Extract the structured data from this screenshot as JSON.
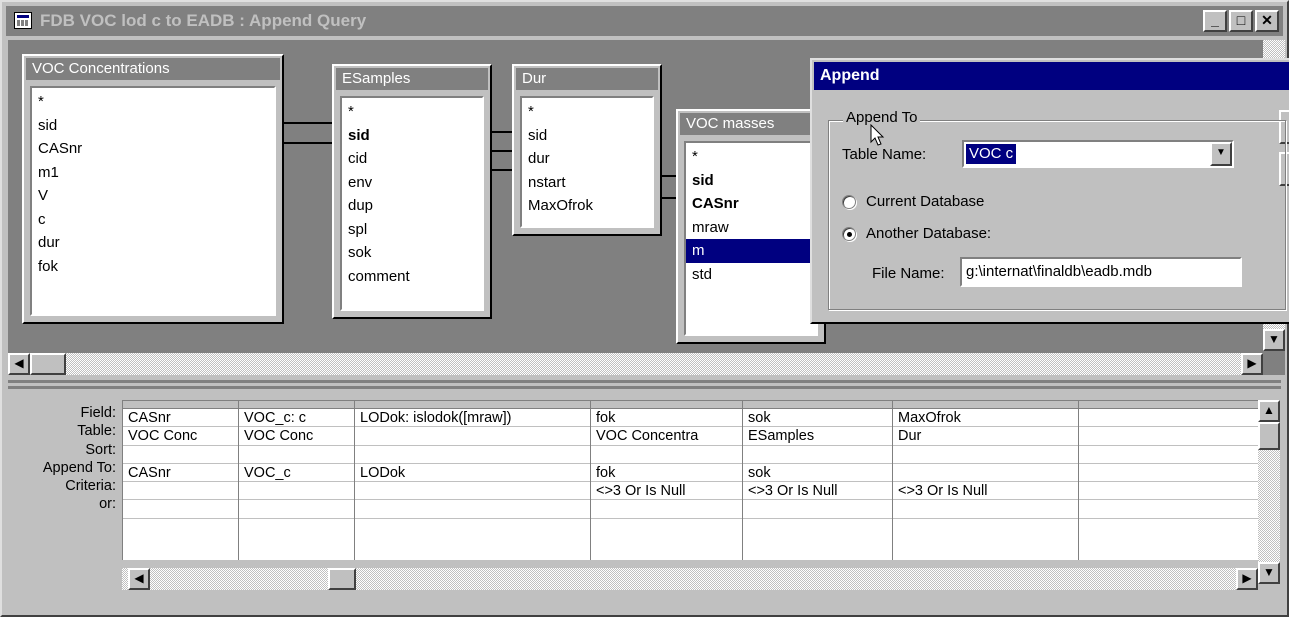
{
  "window": {
    "title": "FDB VOC lod c to EADB : Append Query",
    "minimize_glyph": "_",
    "maximize_glyph": "□",
    "close_glyph": "✕"
  },
  "tables": [
    {
      "caption": "VOC Concentrations",
      "fields": [
        "*",
        "sid",
        "CASnr",
        "m1",
        "V",
        "c",
        "dur",
        "fok"
      ]
    },
    {
      "caption": "ESamples",
      "fields": [
        "*",
        "sid",
        "cid",
        "env",
        "dup",
        "spl",
        "sok",
        "comment"
      ]
    },
    {
      "caption": "Dur",
      "fields": [
        "*",
        "sid",
        "dur",
        "nstart",
        "MaxOfrok"
      ]
    },
    {
      "caption": "VOC masses",
      "fields": [
        "*",
        "sid",
        "CASnr",
        "mraw",
        "m",
        "std"
      ]
    }
  ],
  "grid": {
    "row_labels": [
      "Field:",
      "Table:",
      "Sort:",
      "Append To:",
      "Criteria:",
      "or:"
    ],
    "columns": [
      {
        "field": "CASnr",
        "table": "VOC Conc",
        "sort": "",
        "append_to": "CASnr",
        "criteria": "",
        "or": ""
      },
      {
        "field": "VOC_c: c",
        "table": "VOC Conc",
        "sort": "",
        "append_to": "VOC_c",
        "criteria": "",
        "or": ""
      },
      {
        "field": "LODok: islodok([mraw])",
        "table": "",
        "sort": "",
        "append_to": "LODok",
        "criteria": "",
        "or": ""
      },
      {
        "field": "fok",
        "table": "VOC Concentra",
        "sort": "",
        "append_to": "fok",
        "criteria": "<>3 Or Is Null",
        "or": ""
      },
      {
        "field": "sok",
        "table": "ESamples",
        "sort": "",
        "append_to": "sok",
        "criteria": "<>3 Or Is Null",
        "or": ""
      },
      {
        "field": "MaxOfrok",
        "table": "Dur",
        "sort": "",
        "append_to": "",
        "criteria": "<>3 Or Is Null",
        "or": ""
      },
      {
        "field": "",
        "table": "",
        "sort": "",
        "append_to": "",
        "criteria": "",
        "or": ""
      }
    ]
  },
  "dialog": {
    "title": "Append",
    "group_label": "Append To",
    "table_name_label": "Table Name:",
    "table_name_value": "VOC c",
    "current_db_label": "Current Database",
    "another_db_label": "Another Database:",
    "another_db_selected": true,
    "file_name_label": "File Name:",
    "file_name_value": "g:\\internat\\finaldb\\eadb.mdb"
  },
  "scroll_glyphs": {
    "left": "◀",
    "right": "▶",
    "up": "▲",
    "down": "▼"
  }
}
